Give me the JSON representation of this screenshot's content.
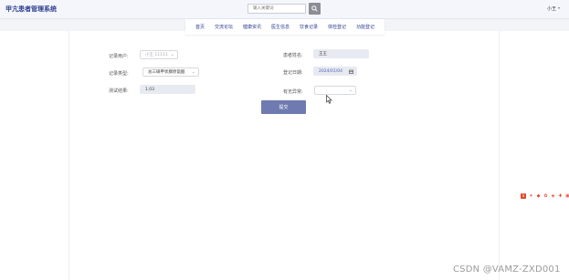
{
  "header": {
    "app_title": "甲亢患者管理系统",
    "search_placeholder": "输入关键词",
    "user_name": "小王",
    "user_caret": "▾"
  },
  "nav": {
    "items": [
      "首页",
      "交流论坛",
      "健康资讯",
      "医生信息",
      "饮食记录",
      "体检登记",
      "功能登记"
    ]
  },
  "form": {
    "record_user_label": "记录用户:",
    "record_user_value": "小王 11111",
    "patient_name_label": "患者姓名:",
    "patient_name_value": "王王",
    "record_type_label": "记录类型:",
    "record_type_value": "总三碘甲状腺原氨酸",
    "record_date_label": "登记日期:",
    "record_date_value": "2024/01/04",
    "test_result_label": "测试结果:",
    "test_result_value": "1.03",
    "is_abnormal_label": "有无异常:",
    "is_abnormal_value": "",
    "submit_label": "提交"
  },
  "watermark": {
    "text": "CSDN @VAMZ-ZXD001"
  },
  "icons": {
    "search": "magnifier-icon",
    "calendar": "calendar-icon",
    "dropdown": "chevron-down-icon",
    "cursor": "mouse-pointer-icon"
  },
  "colors": {
    "brand": "#2c3d8f",
    "submit": "#6f7ab0",
    "search_button": "#8b8e96",
    "field_fill": "#e8eaf1",
    "csdn_red": "#e04a2f"
  }
}
